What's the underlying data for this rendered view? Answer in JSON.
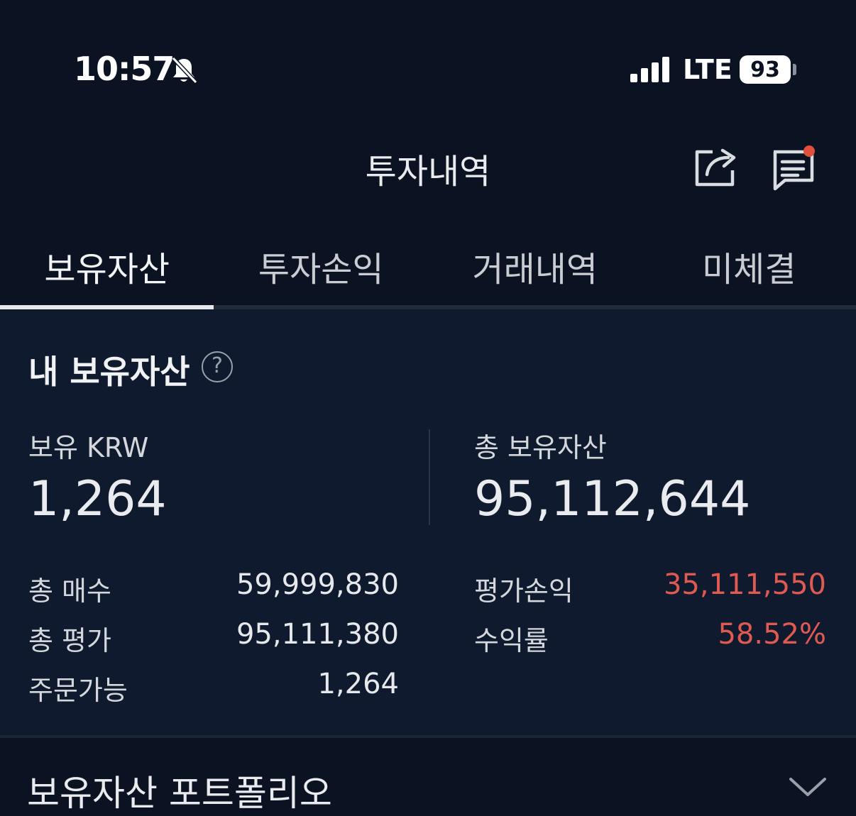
{
  "status_bar": {
    "time": "10:57",
    "network": "LTE",
    "battery": "93"
  },
  "header": {
    "title": "투자내역"
  },
  "tabs": [
    {
      "label": "보유자산",
      "active": true
    },
    {
      "label": "투자손익",
      "active": false
    },
    {
      "label": "거래내역",
      "active": false
    },
    {
      "label": "미체결",
      "active": false
    }
  ],
  "holdings": {
    "title": "내 보유자산",
    "help": "?",
    "krw_label": "보유 KRW",
    "krw_value": "1,264",
    "total_assets_label": "총 보유자산",
    "total_assets_value": "95,112,644",
    "rows_left": [
      {
        "label": "총 매수",
        "value": "59,999,830"
      },
      {
        "label": "총 평가",
        "value": "95,111,380"
      },
      {
        "label": "주문가능",
        "value": "1,264"
      }
    ],
    "rows_right": [
      {
        "label": "평가손익",
        "value": "35,111,550"
      },
      {
        "label": "수익률",
        "value": "58.52%"
      }
    ]
  },
  "portfolio": {
    "title": "보유자산 포트폴리오"
  },
  "colors": {
    "background": "#0b1322",
    "panel": "#101a2e",
    "profit_red": "#e05a52",
    "notification_dot": "#e0503c"
  }
}
